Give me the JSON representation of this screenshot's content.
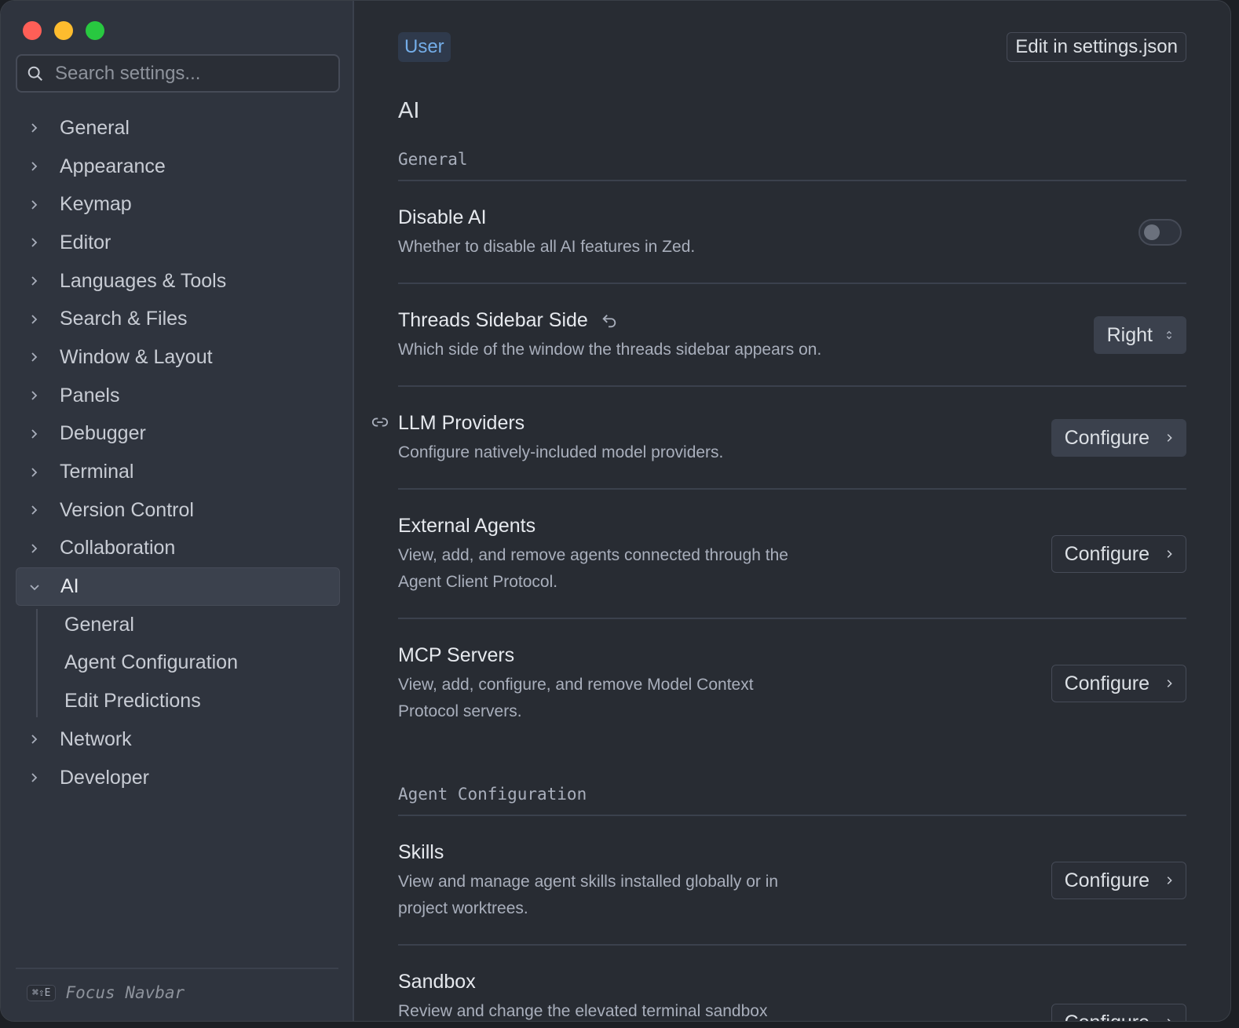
{
  "search": {
    "placeholder": "Search settings..."
  },
  "sidebar": {
    "items": [
      {
        "label": "General"
      },
      {
        "label": "Appearance"
      },
      {
        "label": "Keymap"
      },
      {
        "label": "Editor"
      },
      {
        "label": "Languages & Tools"
      },
      {
        "label": "Search & Files"
      },
      {
        "label": "Window & Layout"
      },
      {
        "label": "Panels"
      },
      {
        "label": "Debugger"
      },
      {
        "label": "Terminal"
      },
      {
        "label": "Version Control"
      },
      {
        "label": "Collaboration"
      },
      {
        "label": "AI"
      },
      {
        "label": "Network"
      },
      {
        "label": "Developer"
      }
    ],
    "ai_subitems": [
      {
        "label": "General"
      },
      {
        "label": "Agent Configuration"
      },
      {
        "label": "Edit Predictions"
      }
    ],
    "footer": {
      "shortcut": "⌘⇧E",
      "label": "Focus Navbar"
    }
  },
  "header": {
    "scope_badge": "User",
    "edit_json_label": "Edit in settings.json"
  },
  "page": {
    "title": "AI",
    "sections": {
      "general": "General",
      "agent_configuration": "Agent Configuration"
    },
    "rows": {
      "disable_ai": {
        "title": "Disable AI",
        "desc": "Whether to disable all AI features in Zed.",
        "enabled": false
      },
      "threads_sidebar": {
        "title": "Threads Sidebar Side",
        "desc": "Which side of the window the threads sidebar appears on.",
        "value": "Right"
      },
      "llm_providers": {
        "title": "LLM Providers",
        "desc": "Configure natively-included model providers.",
        "button": "Configure"
      },
      "external_agents": {
        "title": "External Agents",
        "desc": "View, add, and remove agents connected through the Agent Client Protocol.",
        "button": "Configure"
      },
      "mcp_servers": {
        "title": "MCP Servers",
        "desc": "View, add, configure, and remove Model Context Protocol servers.",
        "button": "Configure"
      },
      "skills": {
        "title": "Skills",
        "desc": "View and manage agent skills installed globally or in project worktrees.",
        "button": "Configure"
      },
      "sandbox": {
        "title": "Sandbox",
        "desc": "Review and change the elevated terminal sandbox",
        "button": "Configure"
      }
    }
  },
  "colors": {
    "accent": "#74ade8",
    "window_bg": "#282c33",
    "sidebar_bg": "#2f343e"
  }
}
